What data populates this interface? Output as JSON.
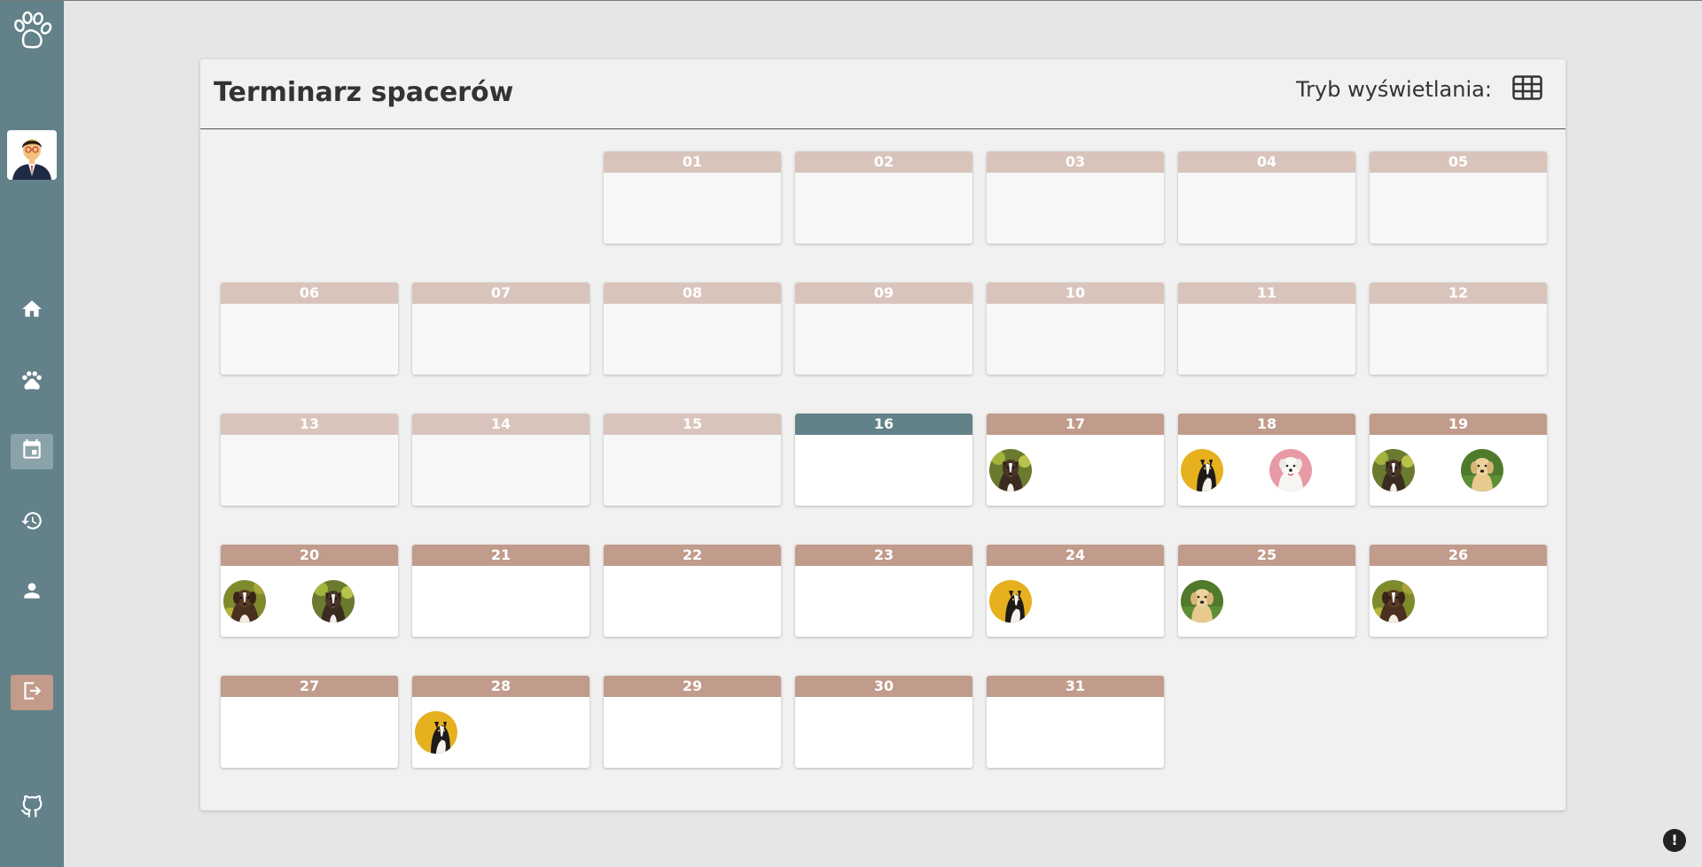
{
  "header": {
    "title": "Terminarz spacerów",
    "mode_label": "Tryb wyświetlania:"
  },
  "sidebar": {
    "items": [
      {
        "name": "home-icon"
      },
      {
        "name": "paw-icon"
      },
      {
        "name": "calendar-icon",
        "active": true
      },
      {
        "name": "history-icon"
      },
      {
        "name": "user-icon"
      },
      {
        "name": "logout-icon"
      },
      {
        "name": "github-icon"
      }
    ]
  },
  "colors": {
    "sidebar": "#628189",
    "accent": "#c19b8b",
    "accent_muted": "#d9c4bc",
    "today": "#628189"
  },
  "calendar": {
    "leading_blank_days": 2,
    "today": "16",
    "days": [
      {
        "label": "01",
        "state": "past",
        "walks": []
      },
      {
        "label": "02",
        "state": "past",
        "walks": []
      },
      {
        "label": "03",
        "state": "past",
        "walks": []
      },
      {
        "label": "04",
        "state": "past",
        "walks": []
      },
      {
        "label": "05",
        "state": "past",
        "walks": []
      },
      {
        "label": "06",
        "state": "past",
        "walks": []
      },
      {
        "label": "07",
        "state": "past",
        "walks": []
      },
      {
        "label": "08",
        "state": "past",
        "walks": []
      },
      {
        "label": "09",
        "state": "past",
        "walks": []
      },
      {
        "label": "10",
        "state": "past",
        "walks": []
      },
      {
        "label": "11",
        "state": "past",
        "walks": []
      },
      {
        "label": "12",
        "state": "past",
        "walks": []
      },
      {
        "label": "13",
        "state": "past",
        "walks": []
      },
      {
        "label": "14",
        "state": "past",
        "walks": []
      },
      {
        "label": "15",
        "state": "past",
        "walks": []
      },
      {
        "label": "16",
        "state": "today",
        "walks": []
      },
      {
        "label": "17",
        "state": "future",
        "walks": [
          "dog-a"
        ]
      },
      {
        "label": "18",
        "state": "future",
        "walks": [
          "dog-b",
          "dog-c"
        ]
      },
      {
        "label": "19",
        "state": "future",
        "walks": [
          "dog-a",
          "dog-d"
        ]
      },
      {
        "label": "20",
        "state": "future",
        "walks": [
          "dog-e",
          "dog-a"
        ]
      },
      {
        "label": "21",
        "state": "future",
        "walks": []
      },
      {
        "label": "22",
        "state": "future",
        "walks": []
      },
      {
        "label": "23",
        "state": "future",
        "walks": []
      },
      {
        "label": "24",
        "state": "future",
        "walks": [
          "dog-b"
        ]
      },
      {
        "label": "25",
        "state": "future",
        "walks": [
          "dog-d"
        ]
      },
      {
        "label": "26",
        "state": "future",
        "walks": [
          "dog-e"
        ]
      },
      {
        "label": "27",
        "state": "future",
        "walks": []
      },
      {
        "label": "28",
        "state": "future",
        "walks": [
          "dog-b"
        ]
      },
      {
        "label": "29",
        "state": "future",
        "walks": []
      },
      {
        "label": "30",
        "state": "future",
        "walks": []
      },
      {
        "label": "31",
        "state": "future",
        "walks": []
      }
    ]
  }
}
